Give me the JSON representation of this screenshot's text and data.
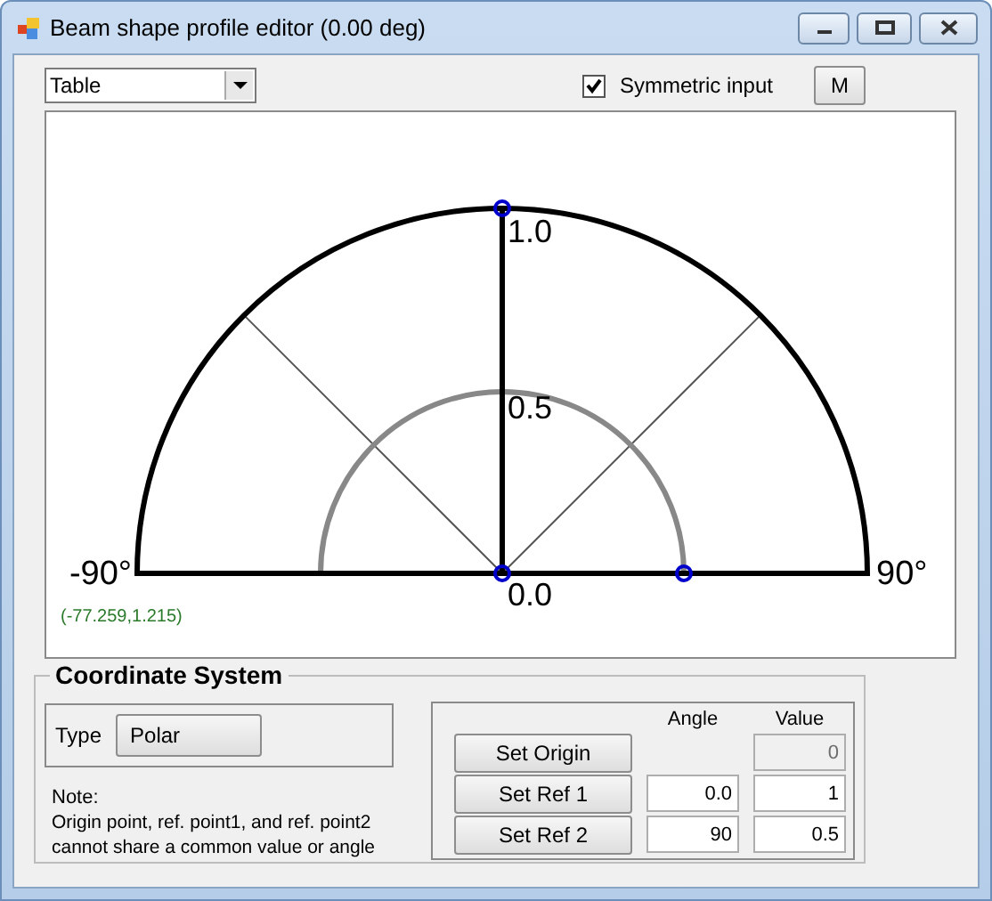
{
  "window": {
    "title": "Beam shape profile editor (0.00 deg)"
  },
  "toolbar": {
    "view_select": {
      "value": "Table"
    },
    "symmetric_input": {
      "label": "Symmetric input",
      "checked": true
    },
    "m_button": {
      "label": "M"
    }
  },
  "plot": {
    "labels": [
      {
        "kind": "top",
        "text": "1.0"
      },
      {
        "kind": "mid",
        "text": "0.5"
      },
      {
        "kind": "origin",
        "text": "0.0"
      },
      {
        "kind": "left",
        "text": "-90°"
      },
      {
        "kind": "right",
        "text": "90°"
      }
    ],
    "cursor_readout": "(-77.259,1.215)"
  },
  "coordinate_system": {
    "title": "Coordinate System",
    "type_label": "Type",
    "type_button": "Polar",
    "note_title": "Note:",
    "note": "Origin point, ref. point1, and ref. point2 cannot share a common value or angle",
    "headers": [
      "Angle",
      "Value"
    ],
    "rows": [
      {
        "button": "Set Origin",
        "value": "0",
        "disabled": true
      },
      {
        "button": "Set Ref 1",
        "angle": "0.0",
        "value": "1",
        "disabled": false
      },
      {
        "button": "Set Ref 2",
        "angle": "90",
        "value": "0.5",
        "disabled": false
      }
    ]
  }
}
